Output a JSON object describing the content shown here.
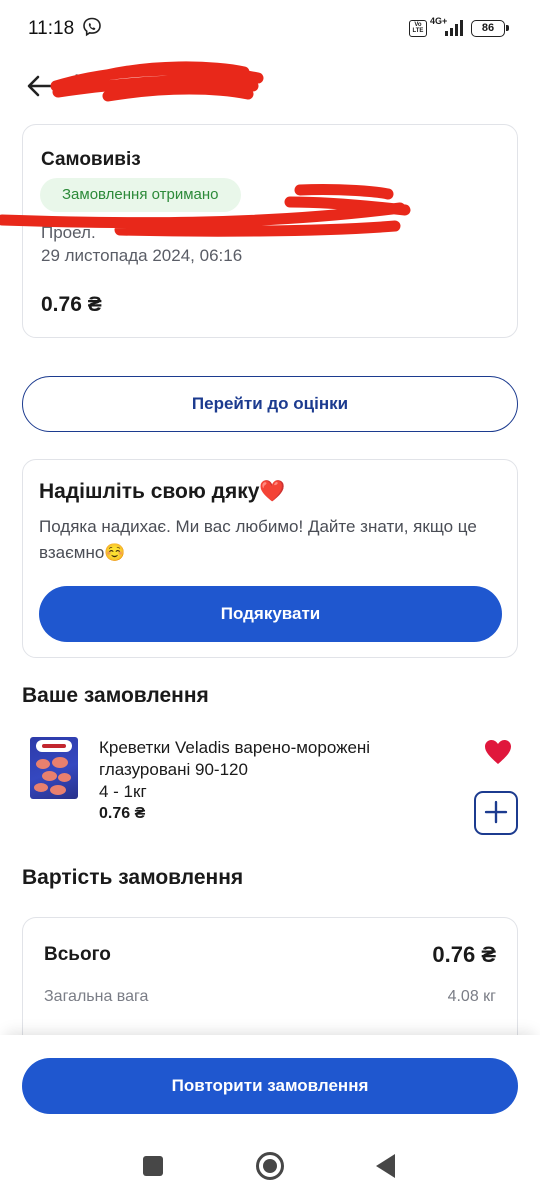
{
  "status_bar": {
    "time": "11:18",
    "volte": "Vo LTE",
    "network": "4G+",
    "battery": "86",
    "icons": [
      "viber-icon",
      "signal-icon",
      "battery-icon"
    ]
  },
  "header": {
    "back_icon": "arrow-left-icon",
    "title": "№"
  },
  "pickup_card": {
    "title": "Самовивіз",
    "status": "Замовлення отримано",
    "issued_label": "Проел.",
    "date": "29 листопада 2024, 06:16",
    "total": "0.76 ₴"
  },
  "rate_button": "Перейти до оцінки",
  "thanks_card": {
    "title": "Надішліть свою дяку❤️",
    "text": "Подяка надихає. Ми вас любимо! Дайте знати, якщо це взаємно☺️",
    "button": "Подякувати"
  },
  "order_section": {
    "title": "Ваше замовлення",
    "items": [
      {
        "name": "Креветки Veladis варено-морожені глазуровані 90-120",
        "quantity": "4 - 1кг",
        "price": "0.76 ₴",
        "favorite_icon": "heart-icon",
        "add_icon": "plus-icon"
      }
    ]
  },
  "cost_section": {
    "title": "Вартість замовлення",
    "total_label": "Всього",
    "total_value": "0.76 ₴",
    "weight_label": "Загальна вага",
    "weight_value": "4.08 кг"
  },
  "bottom_bar": {
    "repeat_button": "Повторити замовлення"
  },
  "colors": {
    "primary": "#1f57cf",
    "outline": "#1c3b8f",
    "success_bg": "#e9f7ea",
    "success_text": "#2c8a39",
    "favorite": "#e0173c",
    "redaction": "#e8281a"
  }
}
